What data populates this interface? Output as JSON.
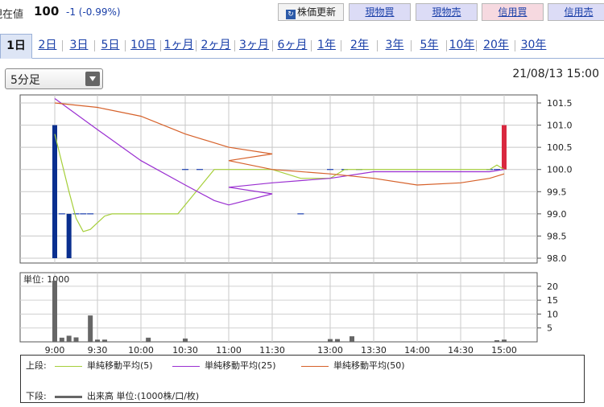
{
  "header": {
    "price_label": "現在値",
    "price": "100",
    "change": "-1 (-0.99%)",
    "refresh_label": "株価更新",
    "refresh_icon": "refresh-icon",
    "buttons": {
      "spot_buy": "現物買",
      "spot_sell": "現物売",
      "margin_buy": "信用買",
      "margin_sell": "信用売"
    }
  },
  "tabs": [
    "1日",
    "2日",
    "3日",
    "5日",
    "10日",
    "1ヶ月",
    "2ヶ月",
    "3ヶ月",
    "6ヶ月",
    "1年",
    "2年",
    "3年",
    "5年",
    "10年",
    "20年",
    "30年"
  ],
  "active_tab": "1日",
  "interval": "5分足",
  "timestamp": "21/08/13 15:00",
  "chart_data": {
    "type": "candlestick+line+bar",
    "price": {
      "ylim": [
        98.0,
        101.5
      ],
      "yticks": [
        "101.5",
        "101.0",
        "100.5",
        "100.0",
        "99.5",
        "99.0",
        "98.5",
        "98.0"
      ],
      "candles": [
        {
          "time": "9:00",
          "open": 101.0,
          "close": 98.0,
          "color": "#0a2f8f"
        },
        {
          "time": "9:10",
          "open": 99.0,
          "close": 98.0,
          "color": "#0a2f8f"
        },
        {
          "time": "15:00",
          "open": 100.0,
          "close": 101.0,
          "color": "#d9283f"
        }
      ],
      "flat_segments": [
        {
          "time": "9:05",
          "price": 99.0
        },
        {
          "time": "9:15",
          "price": 99.0
        },
        {
          "time": "9:20",
          "price": 99.0
        },
        {
          "time": "9:25",
          "price": 99.0
        },
        {
          "time": "10:30",
          "price": 100.0
        },
        {
          "time": "10:40",
          "price": 100.0
        },
        {
          "time": "12:40",
          "price": 99.0
        },
        {
          "time": "13:00",
          "price": 100.0
        },
        {
          "time": "13:10",
          "price": 100.0
        },
        {
          "time": "13:20",
          "price": 100.0
        },
        {
          "time": "14:50",
          "price": 100.0
        },
        {
          "time": "14:55",
          "price": 100.0
        }
      ],
      "series": [
        {
          "name": "単純移動平均(5)",
          "color": "#a6cf3a",
          "points": [
            [
              "9:00",
              100.8
            ],
            [
              "9:10",
              99.5
            ],
            [
              "9:15",
              98.9
            ],
            [
              "9:20",
              98.6
            ],
            [
              "9:25",
              98.65
            ],
            [
              "9:30",
              98.8
            ],
            [
              "9:35",
              98.95
            ],
            [
              "9:40",
              99.0
            ],
            [
              "10:15",
              99.0
            ],
            [
              "10:25",
              99.0
            ],
            [
              "10:40",
              99.6
            ],
            [
              "10:50",
              100.0
            ],
            [
              "12:30",
              100.0
            ],
            [
              "12:40",
              99.8
            ],
            [
              "13:00",
              99.8
            ],
            [
              "13:10",
              100.0
            ],
            [
              "14:50",
              100.0
            ],
            [
              "14:55",
              100.1
            ],
            [
              "15:00",
              100.0
            ]
          ]
        },
        {
          "name": "単純移動平均(25)",
          "color": "#9a2fd1",
          "points": [
            [
              "9:00",
              101.6
            ],
            [
              "9:30",
              100.9
            ],
            [
              "10:00",
              100.2
            ],
            [
              "10:30",
              99.65
            ],
            [
              "10:50",
              99.3
            ],
            [
              "11:00",
              99.2
            ],
            [
              "11:30",
              99.45
            ],
            [
              "12:00",
              99.6
            ],
            [
              "12:30",
              99.7
            ],
            [
              "13:00",
              99.8
            ],
            [
              "13:30",
              99.95
            ],
            [
              "14:00",
              99.95
            ],
            [
              "14:30",
              99.95
            ],
            [
              "14:50",
              99.95
            ],
            [
              "15:00",
              100.0
            ]
          ]
        },
        {
          "name": "単純移動平均(50)",
          "color": "#d6612a",
          "points": [
            [
              "9:00",
              101.5
            ],
            [
              "9:30",
              101.4
            ],
            [
              "10:00",
              101.2
            ],
            [
              "10:30",
              100.8
            ],
            [
              "11:00",
              100.5
            ],
            [
              "11:30",
              100.35
            ],
            [
              "12:00",
              100.2
            ],
            [
              "12:30",
              100.0
            ],
            [
              "13:00",
              99.9
            ],
            [
              "13:30",
              99.8
            ],
            [
              "14:00",
              99.65
            ],
            [
              "14:30",
              99.7
            ],
            [
              "14:50",
              99.8
            ],
            [
              "15:00",
              99.9
            ]
          ]
        }
      ]
    },
    "volume": {
      "unit_label": "単位: 1000",
      "ylim": [
        0,
        22
      ],
      "yticks": [
        "20",
        "15",
        "10",
        "5"
      ],
      "bars": [
        {
          "time": "9:00",
          "value": 22
        },
        {
          "time": "9:05",
          "value": 1.5
        },
        {
          "time": "9:10",
          "value": 2.2
        },
        {
          "time": "9:15",
          "value": 1.6
        },
        {
          "time": "9:25",
          "value": 9.5
        },
        {
          "time": "9:30",
          "value": 0.8
        },
        {
          "time": "9:35",
          "value": 0.8
        },
        {
          "time": "10:05",
          "value": 1.5
        },
        {
          "time": "10:30",
          "value": 1.2
        },
        {
          "time": "13:00",
          "value": 1.0
        },
        {
          "time": "13:05",
          "value": 1.0
        },
        {
          "time": "13:15",
          "value": 2.0
        },
        {
          "time": "14:55",
          "value": 0.6
        },
        {
          "time": "15:00",
          "value": 0.8
        }
      ]
    },
    "x_ticks": [
      "9:00",
      "9:30",
      "10:00",
      "10:30",
      "11:00",
      "11:30",
      "13:00",
      "13:30",
      "14:00",
      "14:30",
      "15:00"
    ]
  },
  "legend": {
    "upper_label": "上段:",
    "lower_label": "下段:",
    "ma5": "単純移動平均(5)",
    "ma25": "単純移動平均(25)",
    "ma50": "単純移動平均(50)",
    "volume": "出来高 単位:(1000株/口/枚)",
    "ma5_color": "#a6cf3a",
    "ma25_color": "#9a2fd1",
    "ma50_color": "#d6612a",
    "volume_color": "#666666"
  }
}
